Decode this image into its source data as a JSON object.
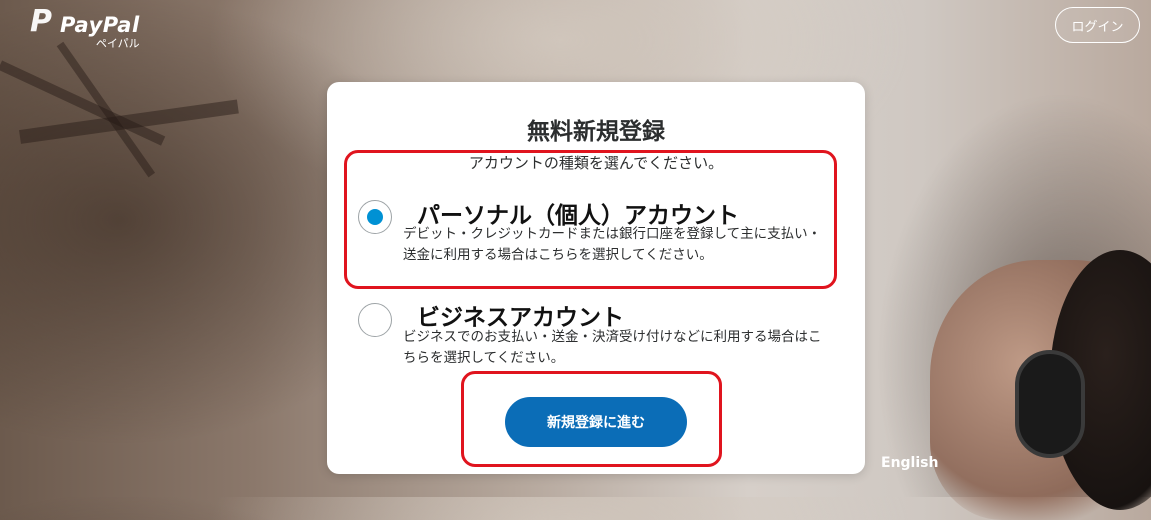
{
  "header": {
    "logo_text": "PayPal",
    "logo_subtext": "ペイパル",
    "login_label": "ログイン"
  },
  "footer": {
    "language_link": "English"
  },
  "signup": {
    "title": "無料新規登録",
    "subtitle": "アカウントの種類を選んでください。",
    "options": [
      {
        "title": "パーソナル（個人）アカウント",
        "description": "デビット・クレジットカードまたは銀行口座を登録して主に支払い・送金に利用する場合はこちらを選択してください。",
        "selected": true
      },
      {
        "title": "ビジネスアカウント",
        "description": "ビジネスでのお支払い・送金・決済受け付けなどに利用する場合はこちらを選択してください。",
        "selected": false
      }
    ],
    "continue_label": "新規登録に進む"
  },
  "colors": {
    "primary_button": "#0b6db7",
    "radio_selected": "#0091d4",
    "highlight": "#e0141e"
  },
  "icons": {
    "logo": "paypal-logo-icon",
    "radio_selected": "radio-checked-icon",
    "radio_unselected": "radio-unchecked-icon"
  }
}
